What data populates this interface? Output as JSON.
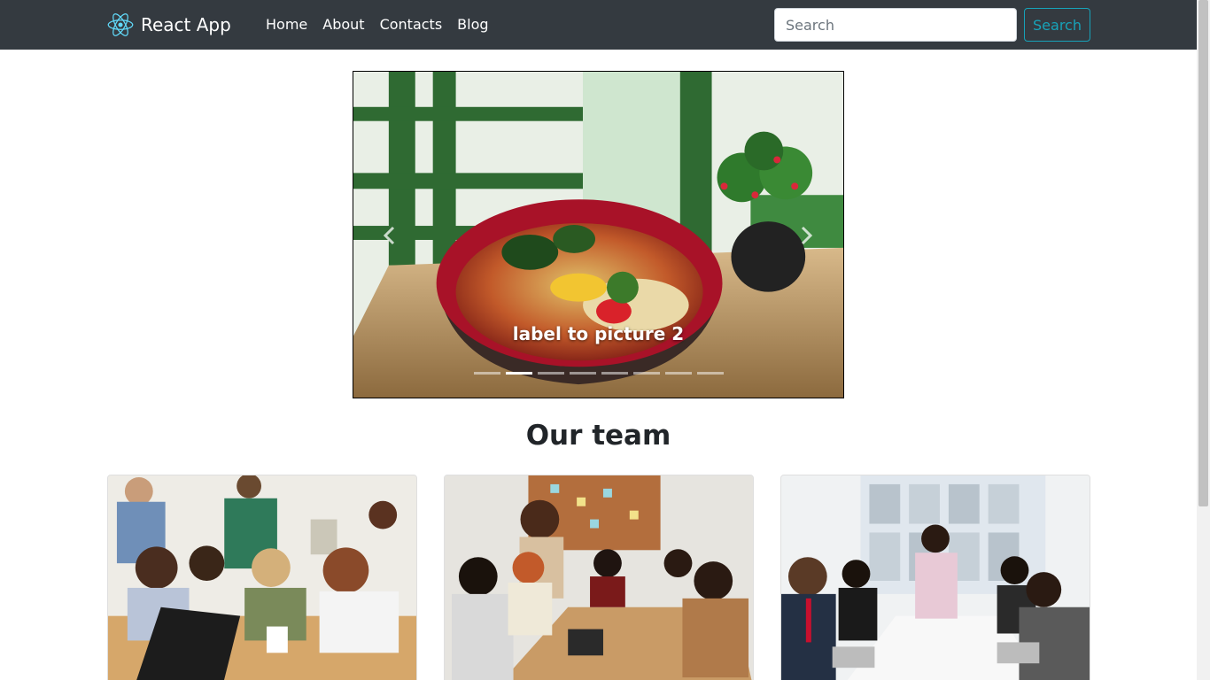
{
  "navbar": {
    "brand": "React App",
    "links": [
      "Home",
      "About",
      "Contacts",
      "Blog"
    ],
    "search_placeholder": "Search",
    "search_button": "Search",
    "brand_color": "#61dafb",
    "background": "#343a40",
    "accent": "#17a2b8"
  },
  "carousel": {
    "caption": "label to picture 2",
    "slide_count": 8,
    "active_index": 1,
    "prev_icon": "chevron-left-icon",
    "next_icon": "chevron-right-icon"
  },
  "team": {
    "heading": "Our team",
    "cards": [
      {
        "image": "team-photo-casual-office"
      },
      {
        "image": "team-photo-handshake-meeting"
      },
      {
        "image": "team-photo-boardroom"
      }
    ]
  }
}
